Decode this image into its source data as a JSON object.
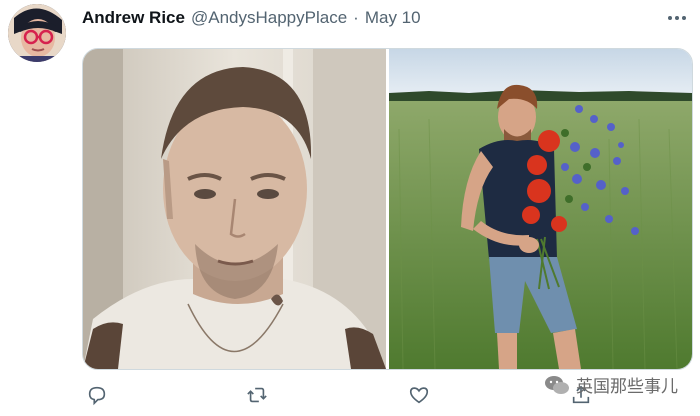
{
  "tweet": {
    "author_name": "Andrew Rice",
    "handle": "@AndysHappyPlace",
    "separator": "·",
    "date": "May 10"
  },
  "media": {
    "photos": [
      {
        "description": "sepia selfie"
      },
      {
        "description": "man holding flower bouquet in field"
      }
    ]
  },
  "actions": [
    {
      "icon": "reply-icon"
    },
    {
      "icon": "retweet-icon"
    },
    {
      "icon": "like-icon"
    },
    {
      "icon": "share-icon"
    }
  ],
  "watermark": {
    "text": "英国那些事儿"
  },
  "colors": {
    "text_primary": "#0f1419",
    "text_secondary": "#536471",
    "border": "#cfd9de"
  }
}
